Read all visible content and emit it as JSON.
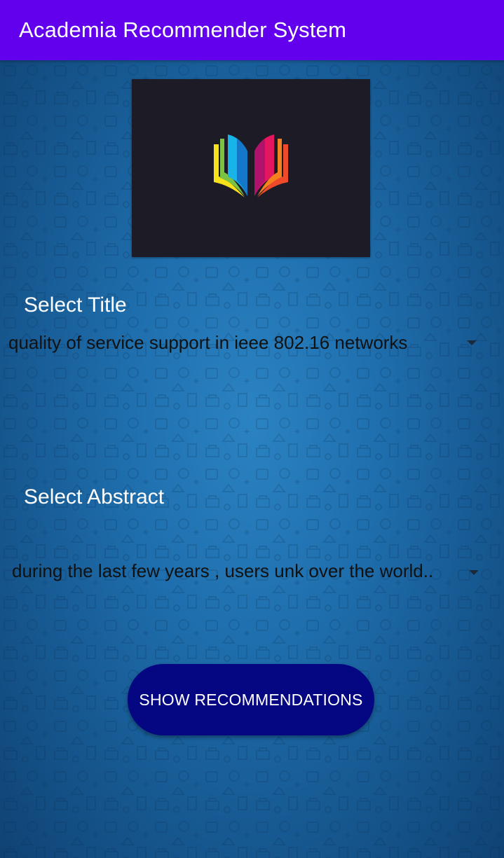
{
  "app_bar": {
    "title": "Academia Recommender System"
  },
  "logo": {
    "icon": "open-book-icon",
    "colors": [
      "#f7e21a",
      "#7bc143",
      "#18b4e8",
      "#1577c9",
      "#e4165f",
      "#b0126c",
      "#f5811f",
      "#ef4b2b"
    ]
  },
  "title_selector": {
    "label": "Select Title",
    "selected_value": "quality of service support in ieee 802.16 networks"
  },
  "abstract_selector": {
    "label": "Select Abstract",
    "selected_value": "during the last few years , users unk over the world.."
  },
  "actions": {
    "show_button_label": "SHOW RECOMMENDATIONS"
  },
  "colors": {
    "app_bar": "#6200ee",
    "button": "#050682",
    "background": "#1f6fae",
    "logo_background": "#1c1b26"
  }
}
